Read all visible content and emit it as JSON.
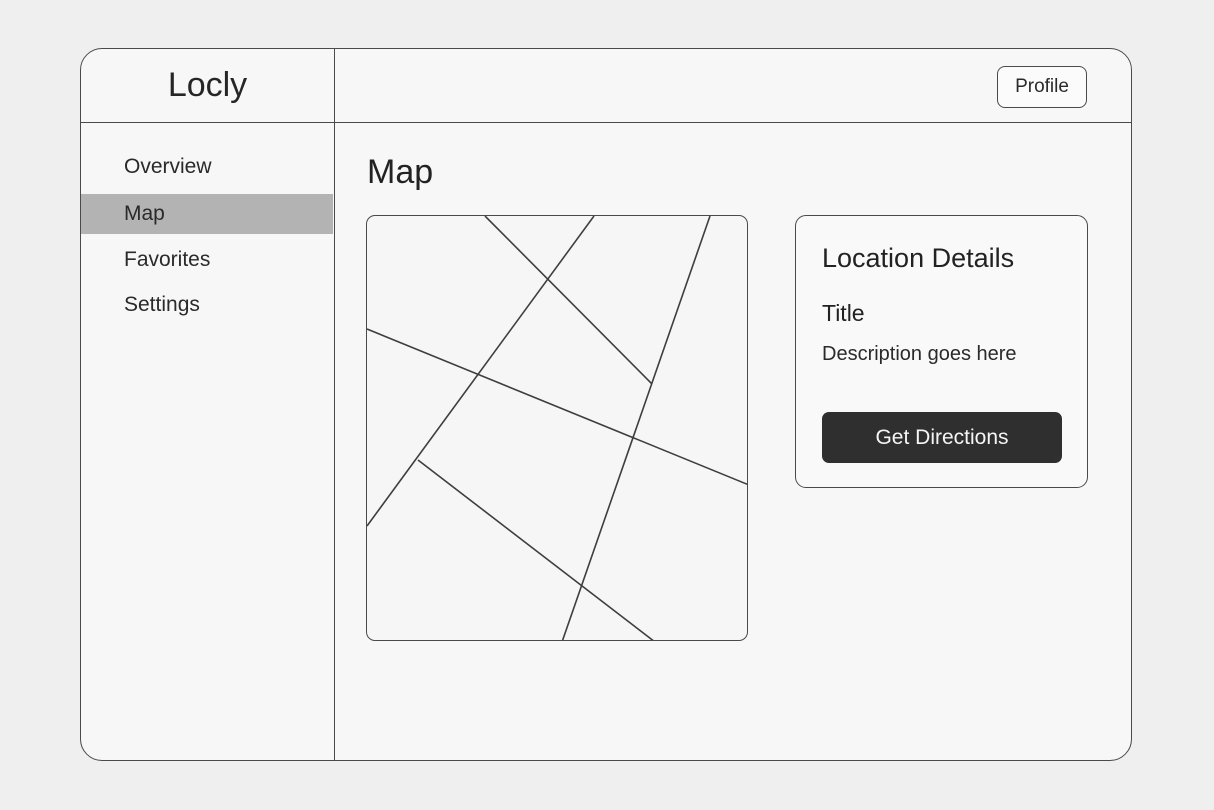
{
  "app": {
    "name": "Locly"
  },
  "header": {
    "profile_label": "Profile"
  },
  "sidebar": {
    "items": [
      {
        "label": "Overview",
        "active": false
      },
      {
        "label": "Map",
        "active": true
      },
      {
        "label": "Favorites",
        "active": false
      },
      {
        "label": "Settings",
        "active": false
      }
    ]
  },
  "main": {
    "title": "Map"
  },
  "details": {
    "heading": "Location Details",
    "title": "Title",
    "description": "Description goes here",
    "button_label": "Get Directions"
  },
  "colors": {
    "background": "#efefef",
    "window": "#f7f7f7",
    "border": "#4a4a4a",
    "active_nav": "#b3b3b3",
    "primary_button": "#2f2f2f"
  },
  "icons": {
    "map": "road-map-placeholder"
  }
}
